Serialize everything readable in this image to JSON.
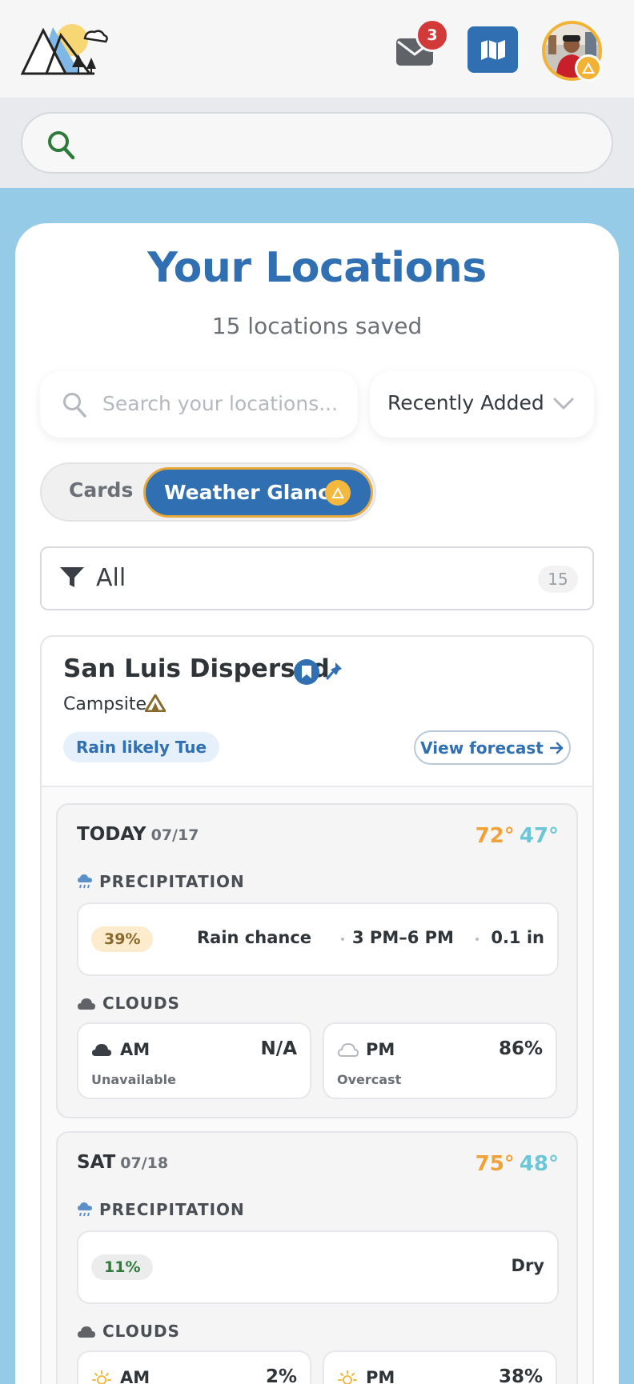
{
  "header": {
    "mail_count": "3",
    "accent": "#2f6fb2",
    "badge_color": "#d23a3a"
  },
  "search": {
    "placeholder": ""
  },
  "page": {
    "title": "Your Locations",
    "subtitle": "15 locations saved",
    "search_placeholder": "Search your locations...",
    "sort_label": "Recently Added"
  },
  "view_toggle": {
    "options": [
      "Cards",
      "Weather Glance"
    ],
    "active": "Weather Glance"
  },
  "filter": {
    "label": "All",
    "count": "15"
  },
  "location": {
    "name": "San Luis Dispersed",
    "type": "Campsite",
    "rain_note": "Rain likely Tue",
    "view_forecast": "View forecast"
  },
  "days": [
    {
      "label": "TODAY",
      "date": "07/17",
      "high": "72°",
      "low": "47°",
      "precip_label": "PRECIPITATION",
      "precip_pct": "39%",
      "precip_text": "Rain chance",
      "precip_window": "3 PM–6 PM",
      "precip_amount": "0.1 in",
      "clouds_label": "CLOUDS",
      "am": {
        "period": "AM",
        "value": "N/A",
        "desc": "Unavailable"
      },
      "pm": {
        "period": "PM",
        "value": "86%",
        "desc": "Overcast"
      }
    },
    {
      "label": "SAT",
      "date": "07/18",
      "high": "75°",
      "low": "48°",
      "precip_label": "PRECIPITATION",
      "precip_pct": "11%",
      "precip_text": "Dry",
      "clouds_label": "CLOUDS",
      "am": {
        "period": "AM",
        "value": "2%"
      },
      "pm": {
        "period": "PM",
        "value": "38%"
      }
    }
  ]
}
